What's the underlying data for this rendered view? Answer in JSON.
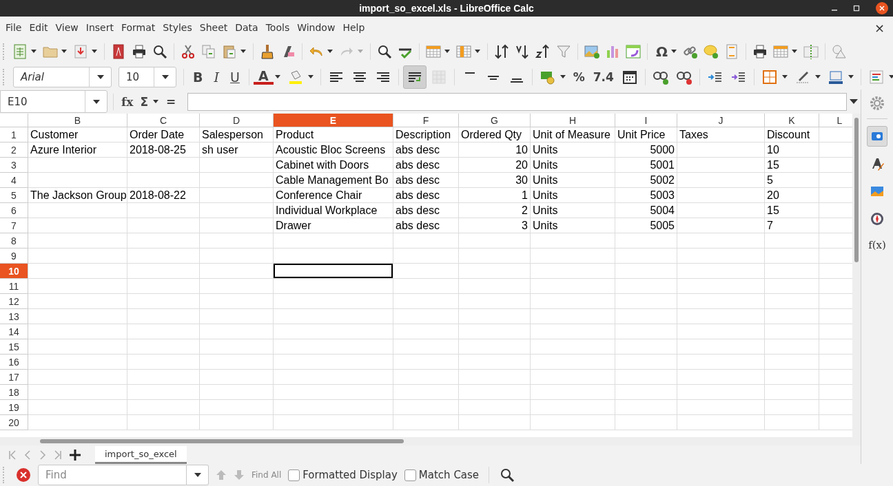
{
  "window": {
    "title": "import_so_excel.xls - LibreOffice Calc"
  },
  "menu": {
    "items": [
      "File",
      "Edit",
      "View",
      "Insert",
      "Format",
      "Styles",
      "Sheet",
      "Data",
      "Tools",
      "Window",
      "Help"
    ],
    "close_glyph": "×"
  },
  "standard_toolbar": {
    "redo_disabled": true,
    "glyph_omega": "Ω"
  },
  "formatting_toolbar": {
    "font_name": "Arial",
    "font_size": "10",
    "bold": "B",
    "italic": "I",
    "underline": "U",
    "font_color": "A",
    "percent": "%",
    "number": "7.4",
    "wrap_text_on": true,
    "merge_disabled": true
  },
  "formula_bar": {
    "name_box": "E10",
    "function_glyph": "fx",
    "sum_glyph": "Σ",
    "equals_glyph": "="
  },
  "grid": {
    "columns": [
      {
        "label": "B",
        "selected": false
      },
      {
        "label": "C",
        "selected": false
      },
      {
        "label": "D",
        "selected": false
      },
      {
        "label": "E",
        "selected": true
      },
      {
        "label": "F",
        "selected": false
      },
      {
        "label": "G",
        "selected": false
      },
      {
        "label": "H",
        "selected": false
      },
      {
        "label": "I",
        "selected": false
      },
      {
        "label": "J",
        "selected": false
      },
      {
        "label": "K",
        "selected": false
      },
      {
        "label": "L",
        "selected": false
      }
    ],
    "rows": [
      {
        "label": "1",
        "selected": false,
        "cells": [
          {
            "text": "Customer",
            "kind": "text"
          },
          {
            "text": "Order Date",
            "kind": "text"
          },
          {
            "text": "Salesperson",
            "kind": "text"
          },
          {
            "text": "Product",
            "kind": "text"
          },
          {
            "text": "Description",
            "kind": "text"
          },
          {
            "text": "Ordered Qty",
            "kind": "text"
          },
          {
            "text": "Unit of Measure",
            "kind": "text"
          },
          {
            "text": "Unit Price",
            "kind": "text"
          },
          {
            "text": "Taxes",
            "kind": "text"
          },
          {
            "text": "Discount",
            "kind": "text"
          },
          null
        ]
      },
      {
        "label": "2",
        "selected": false,
        "cells": [
          {
            "text": "Azure Interior",
            "kind": "text"
          },
          {
            "text": "2018-08-25",
            "kind": "text"
          },
          {
            "text": "sh user",
            "kind": "text"
          },
          {
            "text": "Acoustic Bloc Screens",
            "kind": "text"
          },
          {
            "text": "abs desc",
            "kind": "text"
          },
          {
            "text": "10",
            "kind": "number"
          },
          {
            "text": "Units",
            "kind": "text"
          },
          {
            "text": "5000",
            "kind": "number"
          },
          null,
          {
            "text": "10",
            "kind": "text"
          },
          null
        ]
      },
      {
        "label": "3",
        "selected": false,
        "cells": [
          null,
          null,
          null,
          {
            "text": "Cabinet with Doors",
            "kind": "text"
          },
          {
            "text": "abs desc",
            "kind": "text"
          },
          {
            "text": "20",
            "kind": "number"
          },
          {
            "text": "Units",
            "kind": "text"
          },
          {
            "text": "5001",
            "kind": "number"
          },
          null,
          {
            "text": "15",
            "kind": "text"
          },
          null
        ]
      },
      {
        "label": "4",
        "selected": false,
        "cells": [
          null,
          null,
          null,
          {
            "text": "Cable Management Bo",
            "kind": "text"
          },
          {
            "text": "abs desc",
            "kind": "text"
          },
          {
            "text": "30",
            "kind": "number"
          },
          {
            "text": "Units",
            "kind": "text"
          },
          {
            "text": "5002",
            "kind": "number"
          },
          null,
          {
            "text": "5",
            "kind": "text"
          },
          null
        ]
      },
      {
        "label": "5",
        "selected": false,
        "cells": [
          {
            "text": "The Jackson Group",
            "kind": "text"
          },
          {
            "text": "2018-08-22",
            "kind": "text"
          },
          null,
          {
            "text": "Conference Chair",
            "kind": "text"
          },
          {
            "text": "abs desc",
            "kind": "text"
          },
          {
            "text": "1",
            "kind": "number"
          },
          {
            "text": "Units",
            "kind": "text"
          },
          {
            "text": "5003",
            "kind": "number"
          },
          null,
          {
            "text": "20",
            "kind": "text"
          },
          null
        ]
      },
      {
        "label": "6",
        "selected": false,
        "cells": [
          null,
          null,
          null,
          {
            "text": "Individual Workplace",
            "kind": "text"
          },
          {
            "text": "abs desc",
            "kind": "text"
          },
          {
            "text": "2",
            "kind": "number"
          },
          {
            "text": "Units",
            "kind": "text"
          },
          {
            "text": "5004",
            "kind": "number"
          },
          null,
          {
            "text": "15",
            "kind": "text"
          },
          null
        ]
      },
      {
        "label": "7",
        "selected": false,
        "cells": [
          null,
          null,
          null,
          {
            "text": "Drawer",
            "kind": "text"
          },
          {
            "text": "abs desc",
            "kind": "text"
          },
          {
            "text": "3",
            "kind": "number"
          },
          {
            "text": "Units",
            "kind": "text"
          },
          {
            "text": "5005",
            "kind": "number"
          },
          null,
          {
            "text": "7",
            "kind": "text"
          },
          null
        ]
      },
      {
        "label": "8",
        "selected": false
      },
      {
        "label": "9",
        "selected": false
      },
      {
        "label": "10",
        "selected": true
      },
      {
        "label": "11",
        "selected": false
      },
      {
        "label": "12",
        "selected": false
      },
      {
        "label": "13",
        "selected": false
      },
      {
        "label": "14",
        "selected": false
      },
      {
        "label": "15",
        "selected": false
      },
      {
        "label": "16",
        "selected": false
      },
      {
        "label": "17",
        "selected": false
      },
      {
        "label": "18",
        "selected": false
      },
      {
        "label": "19",
        "selected": false
      },
      {
        "label": "20",
        "selected": false
      }
    ]
  },
  "sheet_tabs": [
    {
      "label": "import_so_excel",
      "selected": true
    }
  ],
  "sidebar": {
    "tabs": [
      {
        "selected": true
      },
      {
        "selected": false
      },
      {
        "selected": false
      },
      {
        "selected": false
      },
      {
        "selected": false,
        "glyph": "f(x)"
      }
    ]
  },
  "find_bar": {
    "placeholder": "Find",
    "find_all": "Find All",
    "options": [
      {
        "label": "Formatted Display",
        "checked": false
      },
      {
        "label": "Match Case",
        "checked": false
      }
    ]
  }
}
